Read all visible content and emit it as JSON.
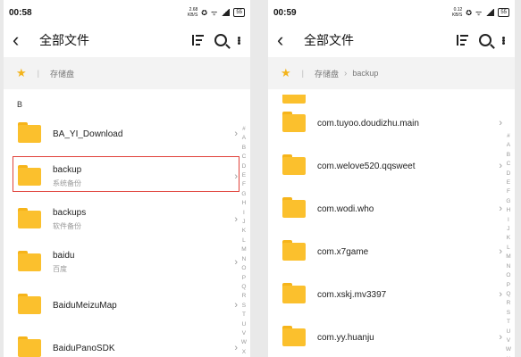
{
  "left": {
    "status": {
      "time": "00:58",
      "net": "2.68",
      "net_unit": "KB/S",
      "battery": "55"
    },
    "title": "全部文件",
    "breadcrumb": [
      "存储盘"
    ],
    "section_letter": "B",
    "items": [
      {
        "name": "BA_YI_Download",
        "sub": ""
      },
      {
        "name": "backup",
        "sub": "系统备份"
      },
      {
        "name": "backups",
        "sub": "软件备份"
      },
      {
        "name": "baidu",
        "sub": "百度"
      },
      {
        "name": "BaiduMeizuMap",
        "sub": ""
      },
      {
        "name": "BaiduPanoSDK",
        "sub": ""
      }
    ],
    "index_letters": [
      "#",
      "A",
      "B",
      "C",
      "D",
      "E",
      "F",
      "G",
      "H",
      "I",
      "J",
      "K",
      "L",
      "M",
      "N",
      "O",
      "P",
      "Q",
      "R",
      "S",
      "T",
      "U",
      "V",
      "W",
      "X"
    ]
  },
  "right": {
    "status": {
      "time": "00:59",
      "net": "0.12",
      "net_unit": "KB/S",
      "battery": "55"
    },
    "title": "全部文件",
    "breadcrumb": [
      "存储盘",
      "backup"
    ],
    "items": [
      {
        "name": "com.tuyoo.doudizhu.main"
      },
      {
        "name": "com.welove520.qqsweet"
      },
      {
        "name": "com.wodi.who"
      },
      {
        "name": "com.x7game"
      },
      {
        "name": "com.xskj.mv3397"
      },
      {
        "name": "com.yy.huanju"
      }
    ],
    "index_letters": [
      "#",
      "A",
      "B",
      "C",
      "D",
      "E",
      "F",
      "G",
      "H",
      "I",
      "J",
      "K",
      "L",
      "M",
      "N",
      "O",
      "P",
      "Q",
      "R",
      "S",
      "T",
      "U",
      "V",
      "W",
      "X"
    ]
  }
}
